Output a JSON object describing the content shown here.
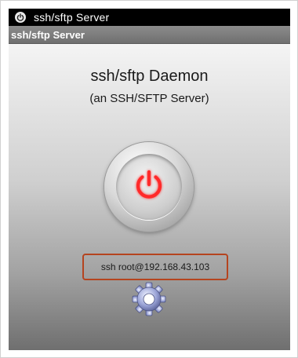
{
  "status_bar": {
    "app_title": "ssh/sftp Server",
    "app_icon": "power-icon"
  },
  "action_bar": {
    "title": "ssh/sftp Server"
  },
  "main": {
    "heading": "ssh/sftp Daemon",
    "subheading": "(an SSH/SFTP Server)",
    "power_button_icon": "power-icon",
    "power_icon_color": "#ff2a2a",
    "connection_string": "ssh root@192.168.43.103",
    "highlight_color": "#b5441f",
    "settings_icon": "gear-icon"
  }
}
